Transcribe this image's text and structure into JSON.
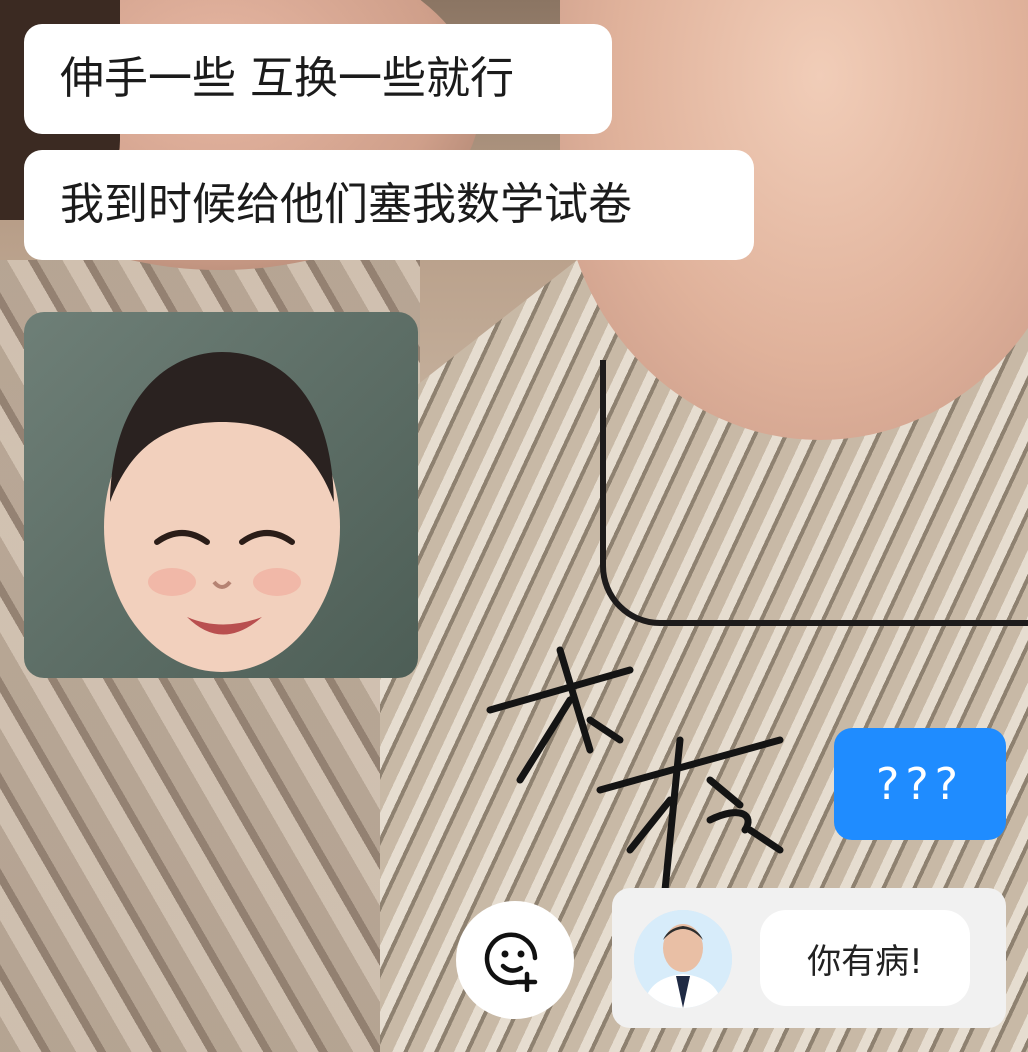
{
  "messages": [
    {
      "text": "伸手一些 互换一些就行"
    },
    {
      "text": "我到时候给他们塞我数学试卷"
    }
  ],
  "sticker": {
    "icon": "smiling-child-sticker"
  },
  "my_message": {
    "text": "???"
  },
  "add_sticker": {
    "icon": "add-emoji-icon"
  },
  "quote": {
    "icon": "doctor-avatar",
    "text": "你有病!"
  },
  "colors": {
    "my_bubble": "#1f8cff",
    "bubble": "#ffffff",
    "quote_bg": "#f1f1f1"
  }
}
